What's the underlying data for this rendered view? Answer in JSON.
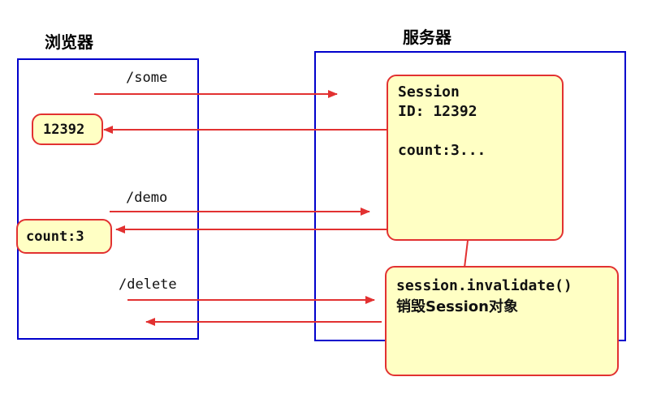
{
  "titles": {
    "browser": "浏览器",
    "server": "服务器"
  },
  "routes": {
    "some": "/some",
    "demo": "/demo",
    "delete": "/delete"
  },
  "browser_notes": {
    "session_id": "12392",
    "count": "count:3"
  },
  "session_note": {
    "line1": "Session",
    "line2": "ID: 12392",
    "line3": "",
    "line4": "count:3..."
  },
  "invalidate_note": {
    "line1": "session.invalidate()",
    "line2": "销毁Session对象"
  },
  "colors": {
    "arrow": "#e23131",
    "panel_border": "#0000cc",
    "note_fill": "#ffffc4",
    "note_border": "#e23131"
  }
}
